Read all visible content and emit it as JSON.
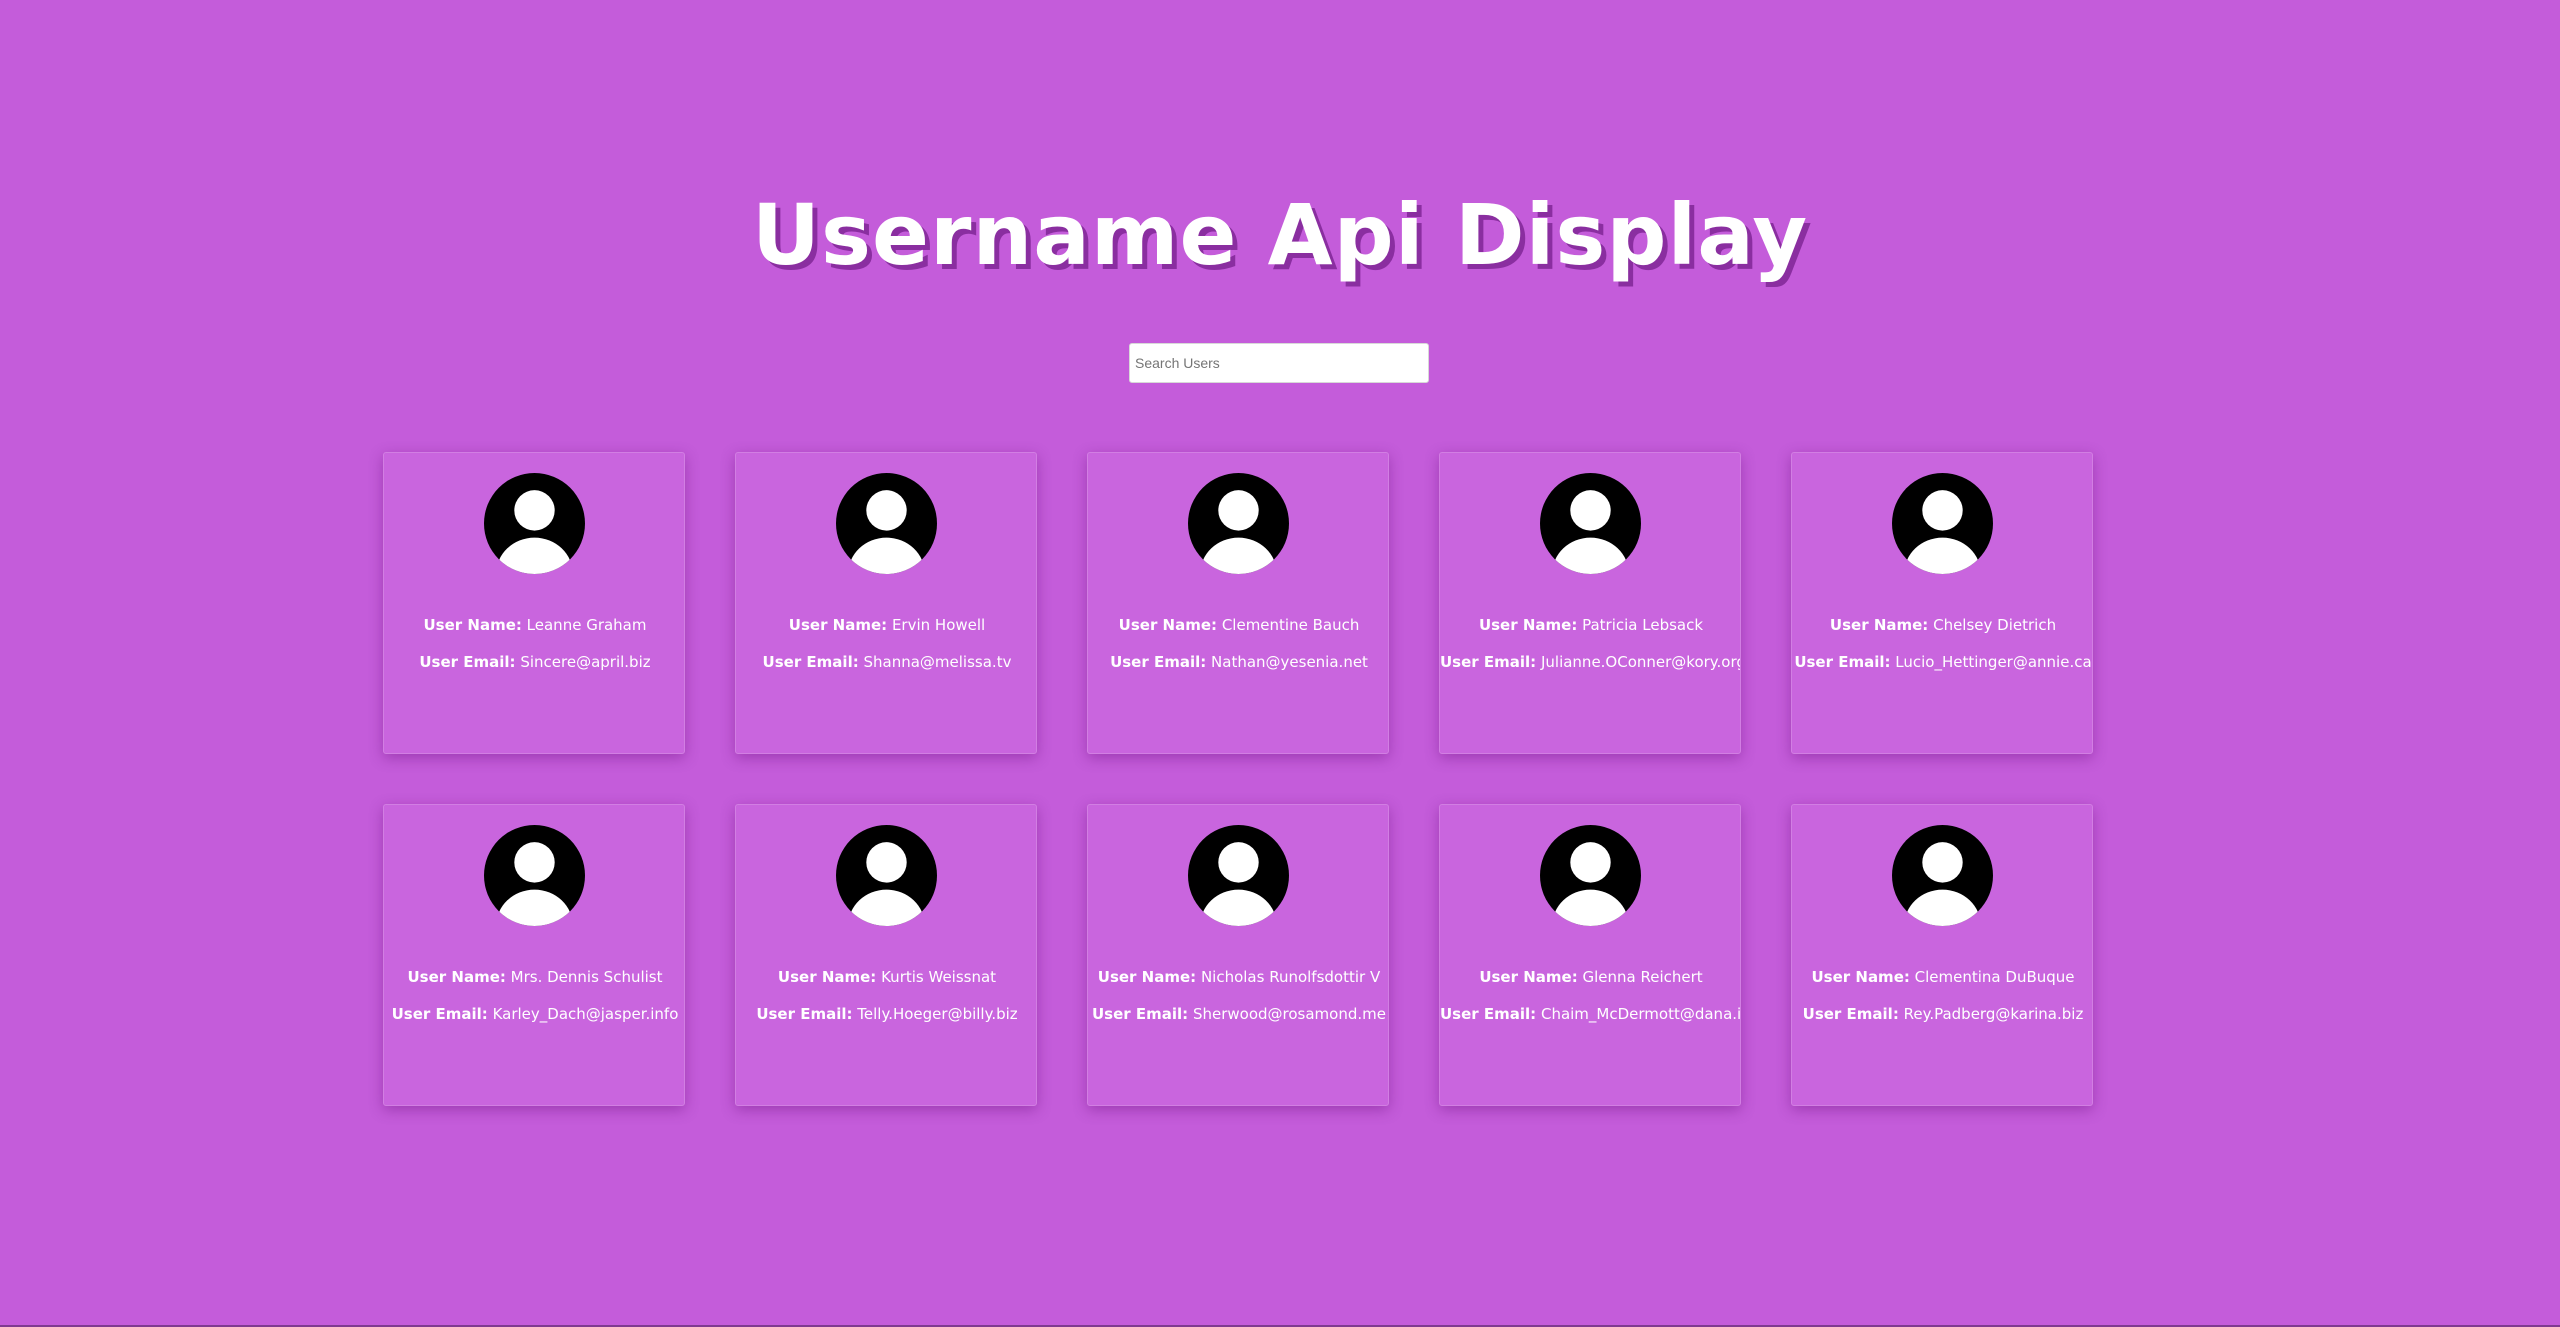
{
  "title": "Username Api Display",
  "search": {
    "placeholder": "Search Users",
    "value": ""
  },
  "labels": {
    "name": "User Name:",
    "email": "User Email:"
  },
  "colors": {
    "background": "#c45cda",
    "card": "#c965de",
    "title_shadow": "#8a2ea0"
  },
  "avatar_icon": "user-avatar-icon",
  "users": [
    {
      "name": "Leanne Graham",
      "email": "Sincere@april.biz"
    },
    {
      "name": "Ervin Howell",
      "email": "Shanna@melissa.tv"
    },
    {
      "name": "Clementine Bauch",
      "email": "Nathan@yesenia.net"
    },
    {
      "name": "Patricia Lebsack",
      "email": "Julianne.OConner@kory.org"
    },
    {
      "name": "Chelsey Dietrich",
      "email": "Lucio_Hettinger@annie.ca"
    },
    {
      "name": "Mrs. Dennis Schulist",
      "email": "Karley_Dach@jasper.info"
    },
    {
      "name": "Kurtis Weissnat",
      "email": "Telly.Hoeger@billy.biz"
    },
    {
      "name": "Nicholas Runolfsdottir V",
      "email": "Sherwood@rosamond.me"
    },
    {
      "name": "Glenna Reichert",
      "email": "Chaim_McDermott@dana.io"
    },
    {
      "name": "Clementina DuBuque",
      "email": "Rey.Padberg@karina.biz"
    }
  ]
}
